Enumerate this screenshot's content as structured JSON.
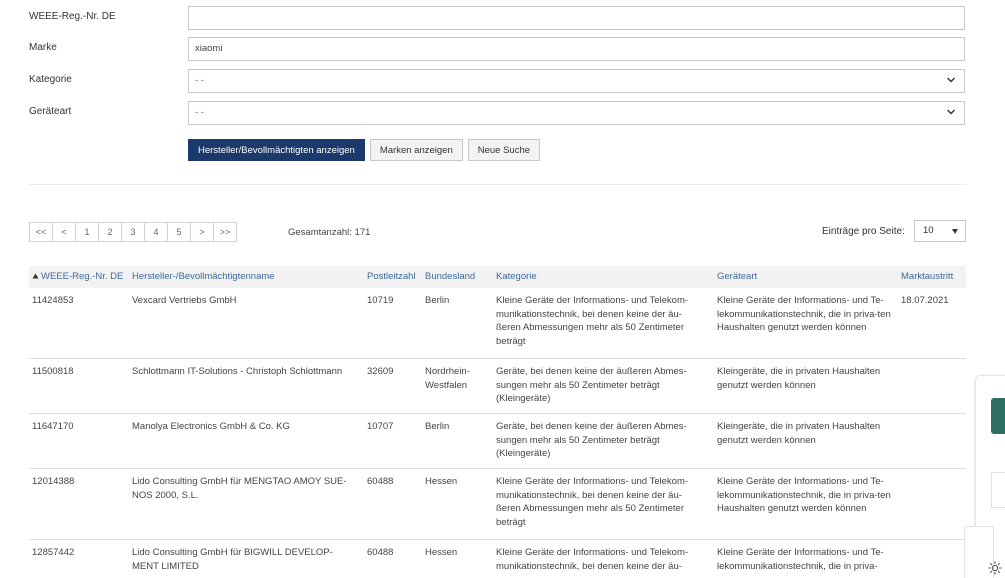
{
  "form": {
    "weee": {
      "label": "WEEE-Reg.-Nr. DE",
      "value": ""
    },
    "marke": {
      "label": "Marke",
      "value": "xiaomi"
    },
    "kategorie": {
      "label": "Kategorie",
      "value": "- -"
    },
    "geraeteart": {
      "label": "Geräteart",
      "value": "- -"
    }
  },
  "buttons": {
    "show_manufacturers": "Hersteller/Bevollmächtigten anzeigen",
    "show_brands": "Marken anzeigen",
    "new_search": "Neue Suche"
  },
  "pagination": {
    "first": "<<",
    "prev": "<",
    "pages": [
      "1",
      "2",
      "3",
      "4",
      "5"
    ],
    "next": ">",
    "last": ">>",
    "total": "Gesamtanzahl: 171",
    "per_page_label": "Einträge pro Seite:",
    "per_page_value": "10"
  },
  "table": {
    "headers": {
      "weee": "WEEE-Reg.-Nr. DE",
      "name": "Hersteller-/Bevollmächtigtenname",
      "plz": "Postleitzahl",
      "bundesland": "Bundesland",
      "kategorie": "Kategorie",
      "geraeteart": "Geräteart",
      "austritt": "Marktaustritt"
    },
    "rows": [
      {
        "weee": "11424853",
        "name": "Vexcard Vertriebs GmbH",
        "plz": "10719",
        "bundesland": "Berlin",
        "kategorie": "Kleine Geräte der Informations- und Telekom-munikationstechnik, bei denen keine der äu-ßeren Abmessungen mehr als 50 Zentimeter beträgt",
        "geraeteart": "Kleine Geräte der Informations- und Te-lekommunikationstechnik, die in priva-ten Haushalten genutzt werden können",
        "austritt": "18.07.2021"
      },
      {
        "weee": "11500818",
        "name": "Schlottmann IT-Solutions - Christoph Schlottmann",
        "plz": "32609",
        "bundesland": "Nordrhein-Westfalen",
        "kategorie": "Geräte, bei denen keine der äußeren Abmes-sungen mehr als 50 Zentimeter beträgt (Kleingeräte)",
        "geraeteart": "Kleingeräte, die in privaten Haushalten genutzt werden können",
        "austritt": ""
      },
      {
        "weee": "11647170",
        "name": "Manolya Electronics GmbH & Co. KG",
        "plz": "10707",
        "bundesland": "Berlin",
        "kategorie": "Geräte, bei denen keine der äußeren Abmes-sungen mehr als 50 Zentimeter beträgt (Kleingeräte)",
        "geraeteart": "Kleingeräte, die in privaten Haushalten genutzt werden können",
        "austritt": ""
      },
      {
        "weee": "12014388",
        "name": "Lido Consulting GmbH für MENGTAO AMOY SUE-NOS 2000, S.L.",
        "plz": "60488",
        "bundesland": "Hessen",
        "kategorie": "Kleine Geräte der Informations- und Telekom-munikationstechnik, bei denen keine der äu-ßeren Abmessungen mehr als 50 Zentimeter beträgt",
        "geraeteart": "Kleine Geräte der Informations- und Te-lekommunikationstechnik, die in priva-ten Haushalten genutzt werden können",
        "austritt": ""
      },
      {
        "weee": "12857442",
        "name": "Lido Consulting GmbH für BIGWILL DEVELOP-MENT LIMITED",
        "plz": "60488",
        "bundesland": "Hessen",
        "kategorie": "Kleine Geräte der Informations- und Telekom-munikationstechnik, bei denen keine der äu-",
        "geraeteart": "Kleine Geräte der Informations- und Te-lekommunikationstechnik, die in priva-",
        "austritt": ""
      }
    ]
  },
  "colors": {
    "primary_button": "#1b3a6b",
    "header_link": "#3e6a9a",
    "side_tab": "#2e6f63"
  }
}
